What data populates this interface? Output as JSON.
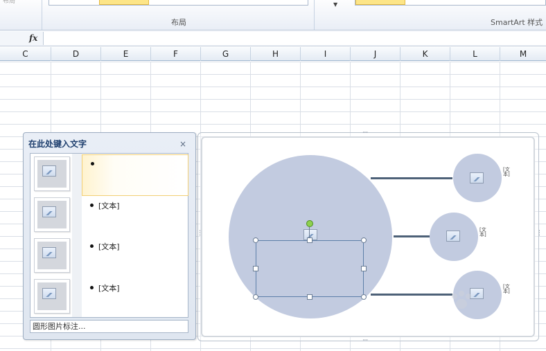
{
  "ribbon": {
    "cut_text": "布局",
    "groups": [
      {
        "label": "布局"
      },
      {
        "label": "SmartArt 样式"
      }
    ]
  },
  "formula_bar": {
    "fx_label": "fx",
    "value": ""
  },
  "columns": [
    "C",
    "D",
    "E",
    "F",
    "G",
    "H",
    "I",
    "J",
    "K",
    "L",
    "M"
  ],
  "text_pane": {
    "title": "在此处键入文字",
    "close_glyph": "×",
    "items": [
      {
        "text": ""
      },
      {
        "text": "[文本]"
      },
      {
        "text": "[文本]"
      },
      {
        "text": "[文本]"
      }
    ],
    "footer": "圆形图片标注..."
  },
  "smartart": {
    "labels": [
      "[文本]",
      "[文本]",
      "[文本]"
    ]
  }
}
